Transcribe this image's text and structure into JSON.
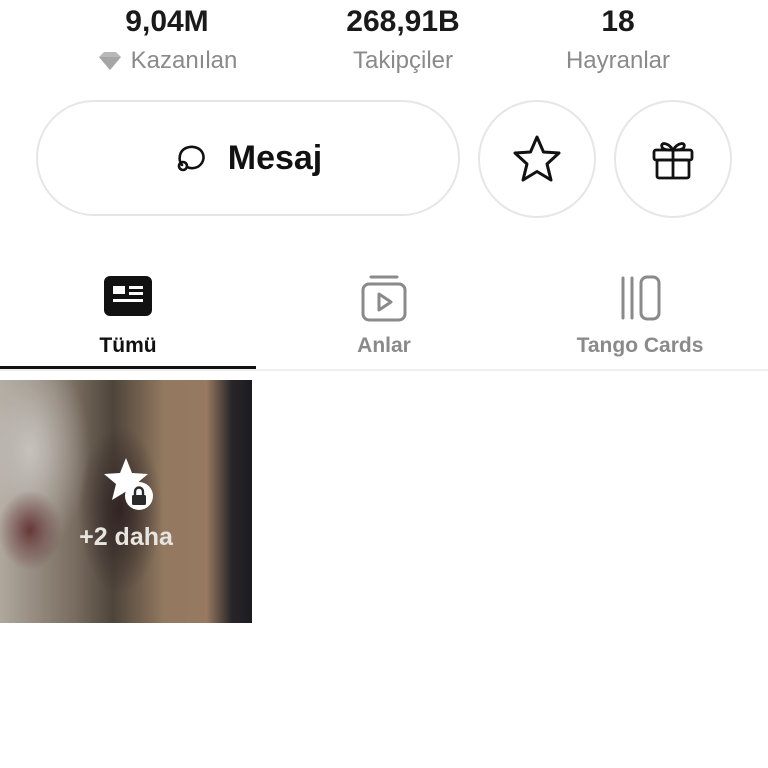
{
  "stats": {
    "earned": {
      "value": "9,04M",
      "label": "Kazanılan",
      "icon": "diamond-icon"
    },
    "followers": {
      "value": "268,91B",
      "label": "Takipçiler"
    },
    "fans": {
      "value": "18",
      "label": "Hayranlar"
    }
  },
  "actions": {
    "message_label": "Mesaj",
    "message_icon": "chat-bubble-icon",
    "favorite_icon": "star-icon",
    "gift_icon": "gift-icon"
  },
  "tabs": [
    {
      "label": "Tümü",
      "icon": "profile-card-icon",
      "active": true
    },
    {
      "label": "Anlar",
      "icon": "video-moments-icon",
      "active": false
    },
    {
      "label": "Tango Cards",
      "icon": "cards-icon",
      "active": false
    }
  ],
  "grid": {
    "items": [
      {
        "more_label": "+2 daha",
        "locked": true,
        "icon": "star-lock-icon"
      }
    ]
  },
  "colors": {
    "text_primary": "#111111",
    "text_secondary": "#8a8a8a",
    "border": "#e6e6e6",
    "active_indicator": "#111111"
  }
}
